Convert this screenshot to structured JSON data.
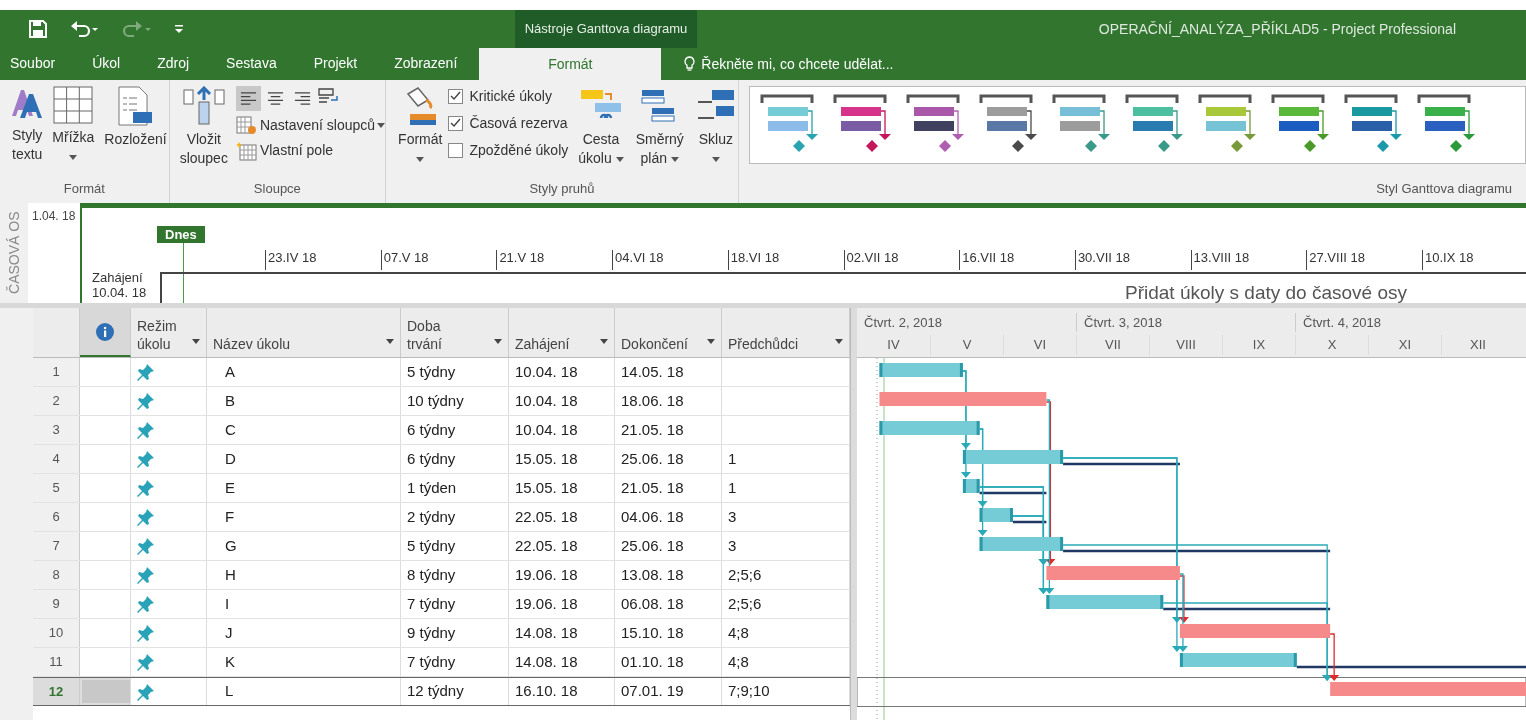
{
  "window": {
    "context_group": "Nástroje Ganttova diagramu",
    "title": "OPERAČNÍ_ANALÝZA_PŘÍKLAD5 - Project Professional"
  },
  "tabs": [
    {
      "label": "Soubor",
      "selected": false
    },
    {
      "label": "Úkol",
      "selected": false
    },
    {
      "label": "Zdroj",
      "selected": false
    },
    {
      "label": "Sestava",
      "selected": false
    },
    {
      "label": "Projekt",
      "selected": false
    },
    {
      "label": "Zobrazení",
      "selected": false
    },
    {
      "label": "Formát",
      "selected": true
    }
  ],
  "tell_me": {
    "placeholder": "Řekněte mi, co chcete udělat..."
  },
  "ribbon": {
    "format_group": {
      "label": "Formát",
      "buttons": [
        {
          "lines": [
            "Styly",
            "textu"
          ],
          "dropdown": false
        },
        {
          "lines": [
            "Mřížka"
          ],
          "dropdown": true
        },
        {
          "lines": [
            "Rozložení"
          ],
          "dropdown": false
        }
      ]
    },
    "columns_group": {
      "label": "Sloupce",
      "insert": {
        "lines": [
          "Vložit",
          "sloupec"
        ]
      },
      "align": [
        {
          "selected": true
        },
        {
          "selected": false
        },
        {
          "selected": false
        }
      ],
      "commands": [
        {
          "label": "Nastavení sloupců",
          "dropdown": true
        },
        {
          "label": "Vlastní pole",
          "dropdown": false
        }
      ]
    },
    "bar_styles_group": {
      "label": "Styly pruhů",
      "format": {
        "lines": [
          "Formát"
        ],
        "dropdown": true
      },
      "checkboxes": [
        {
          "label": "Kritické úkoly",
          "checked": true
        },
        {
          "label": "Časová rezerva",
          "checked": true
        },
        {
          "label": "Zpožděné úkoly",
          "checked": false
        }
      ],
      "buttons": [
        {
          "lines": [
            "Cesta",
            "úkolu"
          ],
          "dropdown": true
        },
        {
          "lines": [
            "Směrný",
            "plán"
          ],
          "dropdown": true
        },
        {
          "lines": [
            "Skluz"
          ],
          "dropdown": true
        }
      ]
    },
    "gallery": {
      "label": "Styl Ganttova diagramu",
      "styles": [
        {
          "bars": [
            {
              "color": "#76ccd6"
            },
            {
              "color": "#8dbbea"
            }
          ],
          "milestone": {
            "color": "#2aa3b0"
          }
        },
        {
          "bars": [
            {
              "color": "#d6338a"
            },
            {
              "color": "#7a5ca5"
            }
          ],
          "milestone": {
            "color": "#c2185b"
          }
        },
        {
          "bars": [
            {
              "color": "#a957a8"
            },
            {
              "color": "#40405f"
            }
          ],
          "milestone": {
            "color": "#b05fb0"
          }
        },
        {
          "bars": [
            {
              "color": "#9c9c9c"
            },
            {
              "color": "#5a78a5"
            }
          ],
          "milestone": {
            "color": "#4a4a4a"
          }
        },
        {
          "bars": [
            {
              "color": "#76bfd6"
            },
            {
              "color": "#9c9c9c"
            }
          ],
          "milestone": {
            "color": "#3a9a8a"
          }
        },
        {
          "bars": [
            {
              "color": "#4cbfa0"
            },
            {
              "color": "#2a7bb0"
            }
          ],
          "milestone": {
            "color": "#3a9a8a"
          }
        },
        {
          "bars": [
            {
              "color": "#a8c83a"
            },
            {
              "color": "#76c3d6"
            }
          ],
          "milestone": {
            "color": "#7a9a3a"
          }
        },
        {
          "bars": [
            {
              "color": "#5ab83a"
            },
            {
              "color": "#1a5cc0"
            }
          ],
          "milestone": {
            "color": "#4a9a2a"
          }
        },
        {
          "bars": [
            {
              "color": "#1a9aa0"
            },
            {
              "color": "#2a60a8"
            }
          ],
          "milestone": {
            "color": "#1a9aa8"
          }
        },
        {
          "bars": [
            {
              "color": "#3ab04a"
            },
            {
              "color": "#2a60c0"
            }
          ],
          "milestone": {
            "color": "#2a9a3a"
          }
        }
      ]
    }
  },
  "timeline": {
    "side_label": "ČASOVÁ OS",
    "start_date": "1.04. 18",
    "today": "Dnes",
    "start_label": "Zahájení",
    "start_value": "10.04. 18",
    "ticks": [
      "23.IV 18",
      "07.V 18",
      "21.V 18",
      "04.VI 18",
      "18.VI 18",
      "02.VII 18",
      "16.VII 18",
      "30.VII 18",
      "13.VIII 18",
      "27.VIII 18",
      "10.IX 18"
    ],
    "hint": "Přidat úkoly s daty do časové osy"
  },
  "table": {
    "columns": [
      {
        "kind": "info"
      },
      {
        "kind": "text",
        "label": "Režim úkolu"
      },
      {
        "kind": "text",
        "label": "Název úkolu"
      },
      {
        "kind": "text",
        "label": "Doba trvání"
      },
      {
        "kind": "text",
        "label": "Zahájení"
      },
      {
        "kind": "text",
        "label": "Dokončení"
      },
      {
        "kind": "text",
        "label": "Předchůdci"
      }
    ],
    "rows": [
      {
        "id": "1",
        "name": "A",
        "duration": "5 týdny",
        "start": "10.04. 18",
        "finish": "14.05. 18",
        "critical": false,
        "selected": false
      },
      {
        "id": "2",
        "name": "B",
        "duration": "10 týdny",
        "start": "10.04. 18",
        "finish": "18.06. 18",
        "critical": true,
        "selected": false
      },
      {
        "id": "3",
        "name": "C",
        "duration": "6 týdny",
        "start": "10.04. 18",
        "finish": "21.05. 18",
        "critical": false,
        "selected": false
      },
      {
        "id": "4",
        "name": "D",
        "duration": "6 týdny",
        "start": "15.05. 18",
        "finish": "25.06. 18",
        "predecessors": "1",
        "critical": false,
        "selected": false
      },
      {
        "id": "5",
        "name": "E",
        "duration": "1 týden",
        "start": "15.05. 18",
        "finish": "21.05. 18",
        "predecessors": "1",
        "critical": false,
        "selected": false
      },
      {
        "id": "6",
        "name": "F",
        "duration": "2 týdny",
        "start": "22.05. 18",
        "finish": "04.06. 18",
        "predecessors": "3",
        "critical": false,
        "selected": false
      },
      {
        "id": "7",
        "name": "G",
        "duration": "5 týdny",
        "start": "22.05. 18",
        "finish": "25.06. 18",
        "predecessors": "3",
        "critical": false,
        "selected": false
      },
      {
        "id": "8",
        "name": "H",
        "duration": "8 týdny",
        "start": "19.06. 18",
        "finish": "13.08. 18",
        "predecessors": "2;5;6",
        "critical": true,
        "selected": false
      },
      {
        "id": "9",
        "name": "I",
        "duration": "7 týdny",
        "start": "19.06. 18",
        "finish": "06.08. 18",
        "predecessors": "2;5;6",
        "critical": false,
        "selected": false
      },
      {
        "id": "10",
        "name": "J",
        "duration": "9 týdny",
        "start": "14.08. 18",
        "finish": "15.10. 18",
        "predecessors": "4;8",
        "critical": true,
        "selected": false
      },
      {
        "id": "11",
        "name": "K",
        "duration": "7 týdny",
        "start": "14.08. 18",
        "finish": "01.10. 18",
        "predecessors": "4;8",
        "critical": false,
        "selected": false
      },
      {
        "id": "12",
        "name": "L",
        "duration": "12 týdny",
        "start": "16.10. 18",
        "finish": "07.01. 19",
        "predecessors": "7;9;10",
        "critical": true,
        "selected": true
      }
    ]
  },
  "gantt": {
    "quarters": [
      "Čtvrt. 2, 2018",
      "Čtvrt. 3, 2018",
      "Čtvrt. 4, 2018"
    ],
    "months": [
      "IV",
      "V",
      "VI",
      "VII",
      "VIII",
      "IX",
      "X",
      "XI",
      "XII"
    ]
  }
}
